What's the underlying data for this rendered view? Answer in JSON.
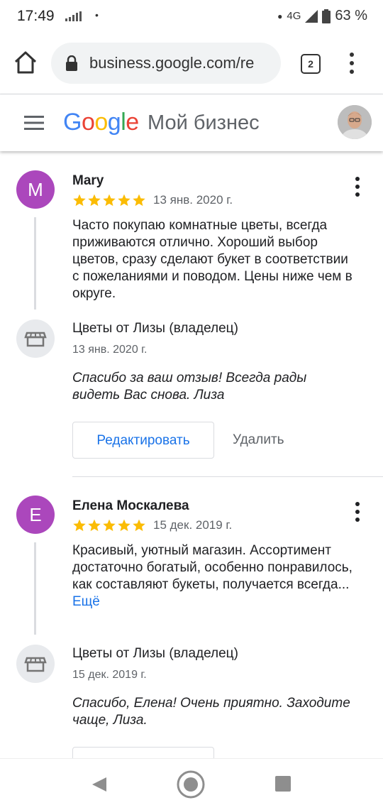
{
  "status_bar": {
    "time": "17:49",
    "dot": "•",
    "network": "4G",
    "battery": "63 %"
  },
  "browser": {
    "url": "business.google.com/re",
    "tab_count": "2"
  },
  "header": {
    "logo_letters": [
      "G",
      "o",
      "o",
      "g",
      "l",
      "e"
    ],
    "product": "Мой бизнес"
  },
  "reviews": [
    {
      "avatar_letter": "M",
      "name": "Mary",
      "rating": 5,
      "date": "13 янв. 2020 г.",
      "text": "Часто покупаю комнатные цветы, всегда приживаются отлично. Хороший выбор цветов, сразу сделают букет в соответствии с пожеланиями и поводом. Цены ниже чем в округе.",
      "reply": {
        "owner": "Цветы от Лизы (владелец)",
        "date": "13 янв. 2020 г.",
        "text": "Спасибо за ваш отзыв! Всегда рады видеть Вас снова. Лиза"
      },
      "edit_label": "Редактировать",
      "delete_label": "Удалить"
    },
    {
      "avatar_letter": "E",
      "name": "Елена Москалева",
      "rating": 5,
      "date": "15 дек. 2019 г.",
      "text": "Красивый, уютный магазин. Ассортимент достаточно богатый, особенно понравилось, как составляют букеты, получается всегда...",
      "more_label": "Ещё",
      "reply": {
        "owner": "Цветы от Лизы (владелец)",
        "date": "15 дек. 2019 г.",
        "text": "Спасибо, Елена! Очень приятно. Заходите чаще, Лиза."
      }
    }
  ],
  "colors": {
    "accent": "#1a73e8",
    "avatar": "#ab47bc",
    "star": "#fbbc04"
  }
}
